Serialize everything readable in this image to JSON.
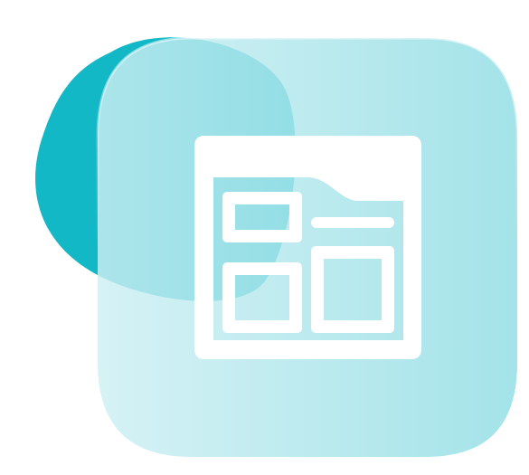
{
  "icon": {
    "name": "browser-window-layout-icon",
    "description_label": "",
    "colors": {
      "blob_primary": "#13B8C6",
      "tile_left": "#CDEFF3",
      "tile_right": "#8FDDE4",
      "glyph": "#FFFFFF"
    }
  }
}
